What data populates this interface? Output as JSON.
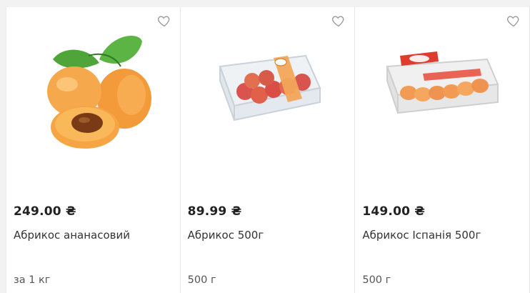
{
  "products": [
    {
      "price": "249.00 ₴",
      "name": "Абрикос ананасовий",
      "unit": "за 1 кг",
      "image_icon": "apricot-fruit-image"
    },
    {
      "price": "89.99 ₴",
      "name": "Абрикос 500г",
      "unit": "500 г",
      "image_icon": "apricot-pack-image"
    },
    {
      "price": "149.00 ₴",
      "name": "Абрикос Іспанія 500г",
      "unit": "500 г",
      "image_icon": "apricot-pack-spain-image"
    }
  ],
  "colors": {
    "heart_outline": "#9a9a9a",
    "apricot": "#f4a64a",
    "leaf": "#4fa43a"
  }
}
